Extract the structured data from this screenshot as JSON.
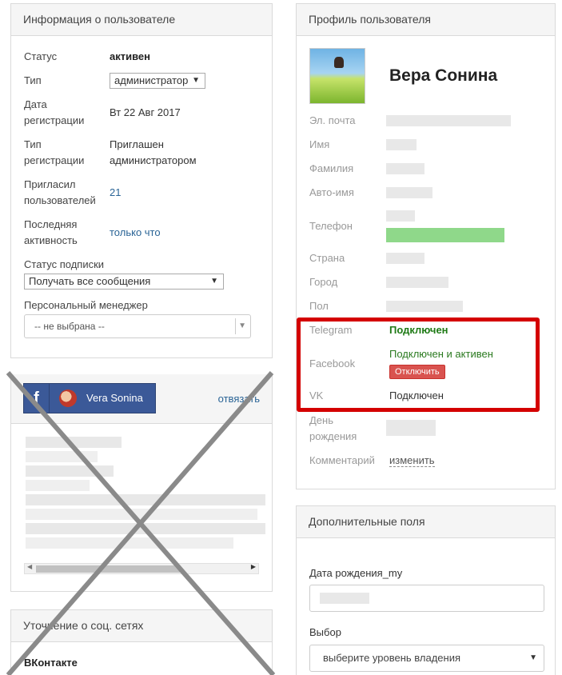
{
  "info": {
    "title": "Информация о пользователе",
    "status_label": "Статус",
    "status_value": "активен",
    "type_label": "Тип",
    "type_value": "администратор",
    "regdate_label_1": "Дата",
    "regdate_label_2": "регистрации",
    "regdate_value": "Вт 22 Авг 2017",
    "regtype_label_1": "Тип",
    "regtype_label_2": "регистрации",
    "regtype_value_1": "Приглашен",
    "regtype_value_2": "администратором",
    "invited_label_1": "Пригласил",
    "invited_label_2": "пользователей",
    "invited_value": "21",
    "activity_label_1": "Последняя",
    "activity_label_2": "активность",
    "activity_value": "только что",
    "subscription_label": "Статус подписки",
    "subscription_value": "Получать все сообщения",
    "manager_label": "Персональный менеджер",
    "manager_value": "-- не выбрана --"
  },
  "social": {
    "fb_letter": "f",
    "fb_name": "Vera Sonina",
    "unlink": "отвязать"
  },
  "clarification": {
    "title": "Уточнение о соц. сетях",
    "vk_heading": "ВКонтакте"
  },
  "profile": {
    "title": "Профиль пользователя",
    "name": "Вера Сонина",
    "email_label": "Эл. почта",
    "firstname_label": "Имя",
    "lastname_label": "Фамилия",
    "autoname_label": "Авто-имя",
    "phone_label": "Телефон",
    "country_label": "Страна",
    "city_label": "Город",
    "gender_label": "Пол",
    "telegram_label": "Telegram",
    "telegram_value": "Подключен",
    "facebook_label": "Facebook",
    "facebook_value": "Подключен и активен",
    "facebook_button": "Отключить",
    "vk_label": "VK",
    "vk_value": "Подключен",
    "birthday_label_1": "День",
    "birthday_label_2": "рождения",
    "comment_label": "Комментарий",
    "comment_link": "изменить"
  },
  "extra": {
    "title": "Дополнительные поля",
    "birthday_field_label": "Дата рождения_my",
    "choice_label": "Выбор",
    "choice_value": "выберите уровень владения"
  },
  "colors": {
    "highlight_box": "#d40000",
    "connected_green": "#1e7a15",
    "disconnect_button": "#d9534f",
    "facebook_blue": "#3b5998",
    "link_blue": "#2a6496"
  }
}
